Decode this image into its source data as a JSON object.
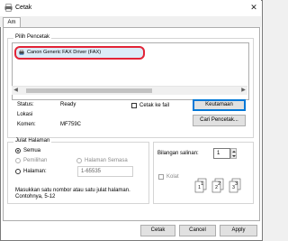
{
  "window": {
    "title": "Cetak",
    "close_glyph": "✕"
  },
  "tabs": [
    {
      "label": "Am"
    }
  ],
  "select_printer": {
    "group_label": "Pilih Pencetak",
    "items": [
      {
        "label": "Canon Generic FAX Driver (FAX)",
        "selected": true
      }
    ],
    "status_label": "Status:",
    "status_value": "Ready",
    "location_label": "Lokasi",
    "location_value": "",
    "comment_label": "Komen:",
    "comment_value": "MF759C",
    "print_to_file_label": "Cetak ke fail",
    "preferences_button": "Keutamaan",
    "find_printer_button": "Cari Pencetak..."
  },
  "page_range": {
    "group_label": "Julat Halaman",
    "all_label": "Semua",
    "selection_label": "Pemilihan",
    "current_page_label": "Halaman Semasa",
    "pages_label": "Halaman:",
    "pages_value": "1-65535",
    "hint": "Masukkan satu nombor atau satu julat halaman. Contohnya, 5-12"
  },
  "copies": {
    "label": "Bilangan salinan:",
    "value": "1",
    "collate_label": "Kolat",
    "collate_glyphs": [
      "1",
      "1",
      "2",
      "2",
      "3",
      "3"
    ]
  },
  "footer": {
    "print_button": "Cetak",
    "cancel_button": "Cancel",
    "apply_button": "Apply"
  },
  "colors": {
    "accent": "#0078d7",
    "highlight_ring": "#e22437"
  },
  "icons": [
    "printer-icon",
    "fax-printer-icon",
    "close-icon",
    "arrow-left-icon",
    "arrow-right-icon",
    "collate-pages-icon",
    "spin-up-icon",
    "spin-down-icon"
  ]
}
